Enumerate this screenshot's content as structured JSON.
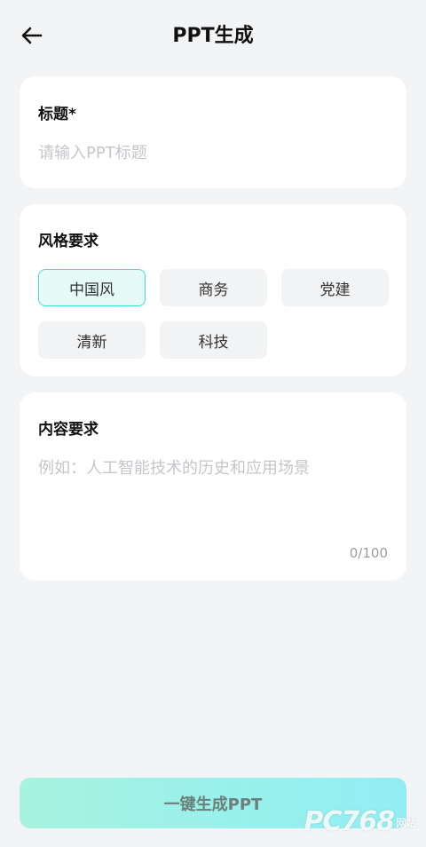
{
  "header": {
    "title": "PPT生成",
    "back_icon": "arrow-left-icon"
  },
  "title_section": {
    "label": "标题*",
    "input_value": "",
    "placeholder": "请输入PPT标题"
  },
  "style_section": {
    "label": "风格要求",
    "options": [
      {
        "label": "中国风",
        "selected": true
      },
      {
        "label": "商务",
        "selected": false
      },
      {
        "label": "党建",
        "selected": false
      },
      {
        "label": "清新",
        "selected": false
      },
      {
        "label": "科技",
        "selected": false
      }
    ]
  },
  "content_section": {
    "label": "内容要求",
    "input_value": "",
    "placeholder": "例如：人工智能技术的历史和应用场景",
    "counter": "0/100"
  },
  "generate_button": {
    "label": "一键生成PPT"
  },
  "watermark": {
    "text": "PC768",
    "sub": "网站"
  },
  "colors": {
    "background": "#f3f4f6",
    "accent": "#3fe0cc",
    "selected_chip_bg": "#e6fbf7",
    "button_gradient_start": "#a7f3de",
    "button_gradient_end": "#92eef4"
  }
}
